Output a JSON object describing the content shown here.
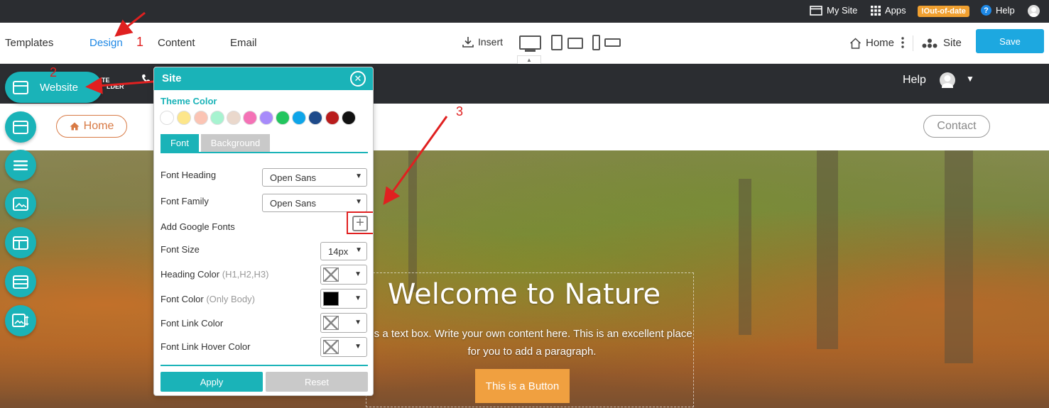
{
  "topbar": {
    "my_site": "My Site",
    "apps": "Apps",
    "out_of_date": "!Out-of-date",
    "help": "Help"
  },
  "toolbar": {
    "tabs": [
      "Templates",
      "Design",
      "Content",
      "Email"
    ],
    "active_tab": "Design",
    "insert": "Insert",
    "home": "Home",
    "site": "Site",
    "save": "Save"
  },
  "site_header": {
    "tiny_left": "TE",
    "tiny_right": "LDER",
    "help": "Help"
  },
  "nav": {
    "home": "Home",
    "contact": "Contact"
  },
  "hero": {
    "title": "Welcome to Nature",
    "text": "is a text box. Write your own content here. This is an excellent place for you to add a paragraph.",
    "button": "This is a Button"
  },
  "left_rail": {
    "website_label": "Website"
  },
  "panel": {
    "title": "Site",
    "theme_color_label": "Theme Color",
    "swatches": [
      "#ffffff",
      "#fde68a",
      "#fbc4b4",
      "#a7f3d0",
      "#ead8cc",
      "#f472b6",
      "#a78bfa",
      "#22c55e",
      "#0ea5e9",
      "#1e4a8a",
      "#b91c1c",
      "#111111"
    ],
    "tabs": {
      "font": "Font",
      "background": "Background"
    },
    "font_heading": {
      "label": "Font Heading",
      "value": "Open Sans"
    },
    "font_family": {
      "label": "Font Family",
      "value": "Open Sans"
    },
    "add_google_fonts": "Add Google Fonts",
    "font_size": {
      "label": "Font Size",
      "value": "14px"
    },
    "heading_color": {
      "label": "Heading Color",
      "hint": "(H1,H2,H3)"
    },
    "font_color": {
      "label": "Font Color",
      "hint": "(Only Body)"
    },
    "link_color": {
      "label": "Font Link Color"
    },
    "link_hover_color": {
      "label": "Font Link Hover Color"
    },
    "apply": "Apply",
    "reset": "Reset"
  },
  "annotations": {
    "n1": "1",
    "n2": "2",
    "n3": "3"
  },
  "colors": {
    "accent": "#1ab3b8",
    "save": "#1da8e0",
    "annotation": "#e02020",
    "hero_button": "#f0a040"
  }
}
